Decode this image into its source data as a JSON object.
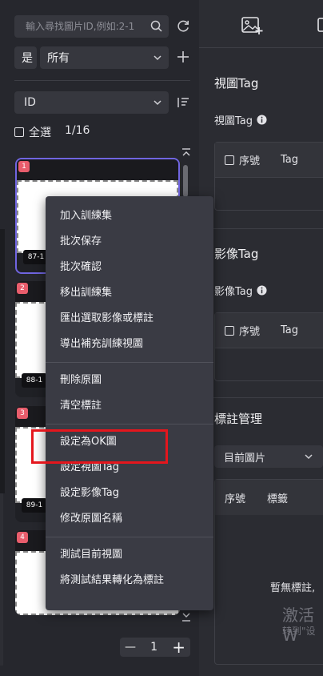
{
  "search": {
    "placeholder": "輸入尋找圖片ID,例如:2-1"
  },
  "filter": {
    "operator": "是",
    "value": "所有"
  },
  "sort": {
    "field": "ID"
  },
  "selection": {
    "select_all_label": "全選",
    "page_count": "1/16"
  },
  "thumbnails": [
    {
      "badge": "1",
      "label": "87-1"
    },
    {
      "badge": "2",
      "label": "88-1"
    },
    {
      "badge": "3",
      "label": "89-1"
    },
    {
      "badge": "4",
      "label": ""
    }
  ],
  "pager": {
    "minus": "—",
    "page": "1",
    "plus": "+"
  },
  "context_menu": {
    "group1": [
      "加入訓練集",
      "批次保存",
      "批次確認",
      "移出訓練集",
      "匯出選取影像或標註",
      "導出補充訓練視圖"
    ],
    "group2": [
      "刪除原圖",
      "清空標註"
    ],
    "group3": [
      "設定為OK圖",
      "設定視圖Tag",
      "設定影像Tag",
      "修改原圖名稱"
    ],
    "group4": [
      "測試目前視圖",
      "將測試結果轉化為標註"
    ]
  },
  "right_panel": {
    "view_tag_title": "視圖Tag",
    "view_tag_sub": "視圖Tag",
    "image_tag_title": "影像Tag",
    "image_tag_sub": "影像Tag",
    "col_index": "序號",
    "col_tag": "Tag",
    "annotation_title": "標註管理",
    "current_image": "目前圖片",
    "col_label": "標籤",
    "empty_text": "暫無標註,",
    "watermark_line1": "激活 W",
    "watermark_line2": "转到\"设"
  },
  "colors": {
    "accent": "#7065e0",
    "badge": "#e85d6c",
    "highlight": "#e4161d"
  }
}
